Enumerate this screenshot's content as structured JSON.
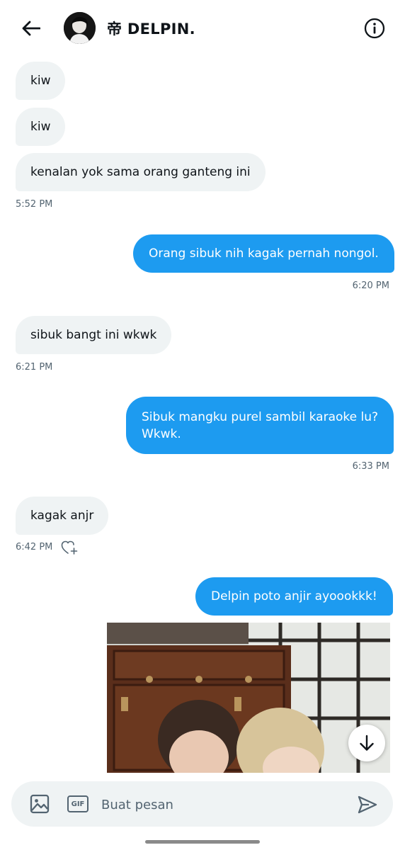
{
  "header": {
    "title": "帝 DELPIN.",
    "back_icon": "arrow-left-icon",
    "info_icon": "info-icon"
  },
  "messages": [
    {
      "text": "kiw"
    },
    {
      "text": "kiw"
    },
    {
      "text": "kenalan yok sama orang ganteng ini"
    },
    {
      "text": "Orang sibuk nih kagak pernah nongol."
    },
    {
      "text": "sibuk bangt ini wkwk"
    },
    {
      "line1": "Sibuk mangku purel sambil karaoke lu?",
      "line2": "Wkwk."
    },
    {
      "text": "kagak anjr"
    },
    {
      "text": "Delpin poto anjir ayoookkk!"
    }
  ],
  "timestamps": [
    "5:52 PM",
    "6:20 PM",
    "6:21 PM",
    "6:33 PM",
    "6:42 PM"
  ],
  "composer": {
    "placeholder": "Buat pesan",
    "gif_label": "GIF",
    "media_icon": "image-icon",
    "send_icon": "send-icon"
  },
  "colors": {
    "accent": "#1d9bf0",
    "incoming_bubble": "#eff3f4",
    "secondary_text": "#536471"
  }
}
